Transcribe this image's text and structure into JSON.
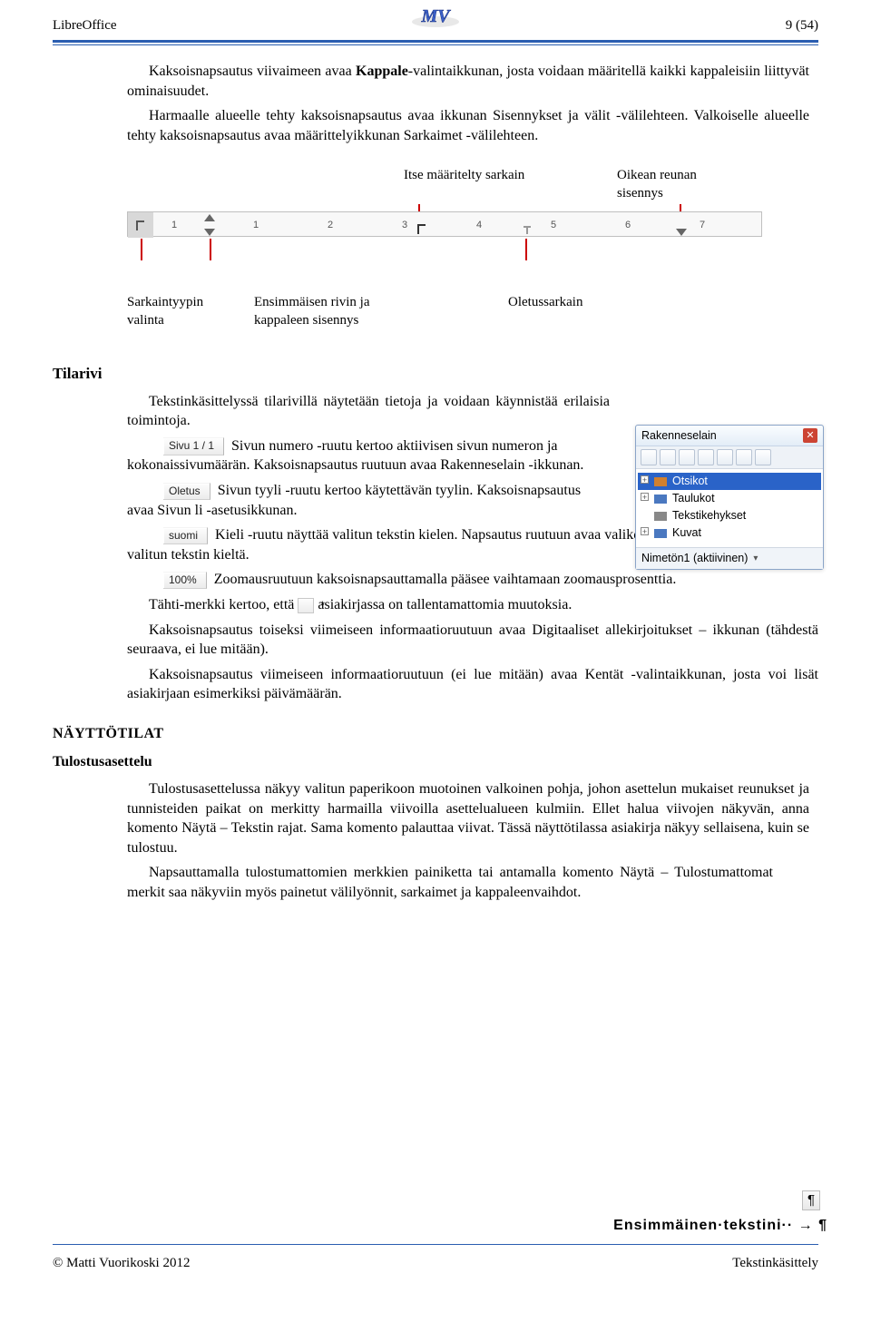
{
  "header": {
    "left": "LibreOffice",
    "right": "9 (54)",
    "logo_initials": "MV"
  },
  "footer": {
    "left": "© Matti Vuorikoski  2012",
    "right": "Tekstinkäsittely"
  },
  "intro": {
    "p1a": "Kaksoisnapsautus viivaimeen avaa ",
    "p1b": "Kappale",
    "p1c": "-valintaikkunan, josta voidaan määritellä kaikki kappaleisiin liittyvät ominaisuudet.",
    "p2": "Harmaalle alueelle tehty kaksoisnapsautus avaa ikkunan Sisennykset ja välit -välilehteen. Valkoiselle alueelle tehty kaksoisnapsautus avaa määrittelyikkunan Sarkaimet -välilehteen."
  },
  "ruler": {
    "top_labels": {
      "custom_tab": "Itse määritelty sarkain",
      "right_indent": "Oikean reunan sisennys"
    },
    "bottom_labels": {
      "tab_type": "Sarkaintyypin valinta",
      "first_line": "Ensimmäisen rivin ja kappaleen sisennys",
      "default_tab": "Oletussarkain"
    },
    "ticks": [
      "1",
      "1",
      "2",
      "3",
      "4",
      "5",
      "6",
      "7"
    ]
  },
  "tilarivi": {
    "heading": "Tilarivi",
    "p1": "Tekstinkäsittelyssä tilarivillä näytetään tietoja ja voidaan käynnistää erilaisia toimintoja.",
    "chip_page": "Sivu 1 / 1",
    "p2": "Sivun numero -ruutu kertoo aktiivisen sivun numeron ja kokonaissivumäärän. Kaksoisnapsautus ruutuun avaa Rakenneselain -ikkunan.",
    "chip_style": "Oletus",
    "p3": "Sivun tyyli -ruutu kertoo käytettävän tyylin. Kaksoisnapsautus avaa Sivun li -asetusikkunan.",
    "chip_lang": "suomi",
    "p4": "Kieli -ruutu näyttää valitun tekstin kielen. Napsautus ruutuun avaa valikon, josta voi tehdä vaihtaa valitun tekstin kieltä.",
    "chip_zoom": "100%",
    "p5": "Zoomausruutuun kaksoisnapsauttamalla pääsee vaihtamaan zoomausprosenttia.",
    "star": "*",
    "p6a": "Tähti-merkki kertoo, että",
    "p6b": "asiakirjassa on tallentamattomia muutoksia.",
    "p7": "Kaksoisnapsautus toiseksi viimeiseen informaatioruutuun avaa Digitaaliset allekirjoitukset – ikkunan (tähdestä seuraava, ei lue mitään).",
    "p8": "Kaksoisnapsautus viimeiseen informaatioruutuun (ei lue mitään) avaa Kentät -valintaikkunan, josta voi lisät asiakirjaan esimerkiksi päivämäärän."
  },
  "navigator": {
    "title": "Rakenneselain",
    "items": [
      "Otsikot",
      "Taulukot",
      "Tekstikehykset",
      "Kuvat"
    ],
    "footer": "Nimetön1 (aktiivinen)"
  },
  "nayttotilat": {
    "heading": "NÄYTTÖTILAT",
    "sub_heading": "Tulostusasettelu",
    "p1": "Tulostusasettelussa näkyy valitun paperikoon muotoinen valkoinen pohja, johon asettelun mukaiset reunukset ja tunnisteiden paikat on merkitty harmailla viivoilla asettelualueen kulmiin. Ellet halua viivojen näkyvän, anna komento Näytä – Tekstin rajat. Sama komento palauttaa viivat. Tässä näyttötilassa asiakirja näkyy sellaisena, kuin se tulostuu.",
    "p2": "Napsauttamalla tulostumattomien merkkien painiketta tai antamalla komento Näytä – Tulostumattomat merkit saa näkyviin myös painetut välilyönnit, sarkaimet ja kappaleenvaihdot."
  },
  "sample": {
    "pilcrow": "¶",
    "text": "Ensimmäinen·tekstini··  →  ¶"
  }
}
